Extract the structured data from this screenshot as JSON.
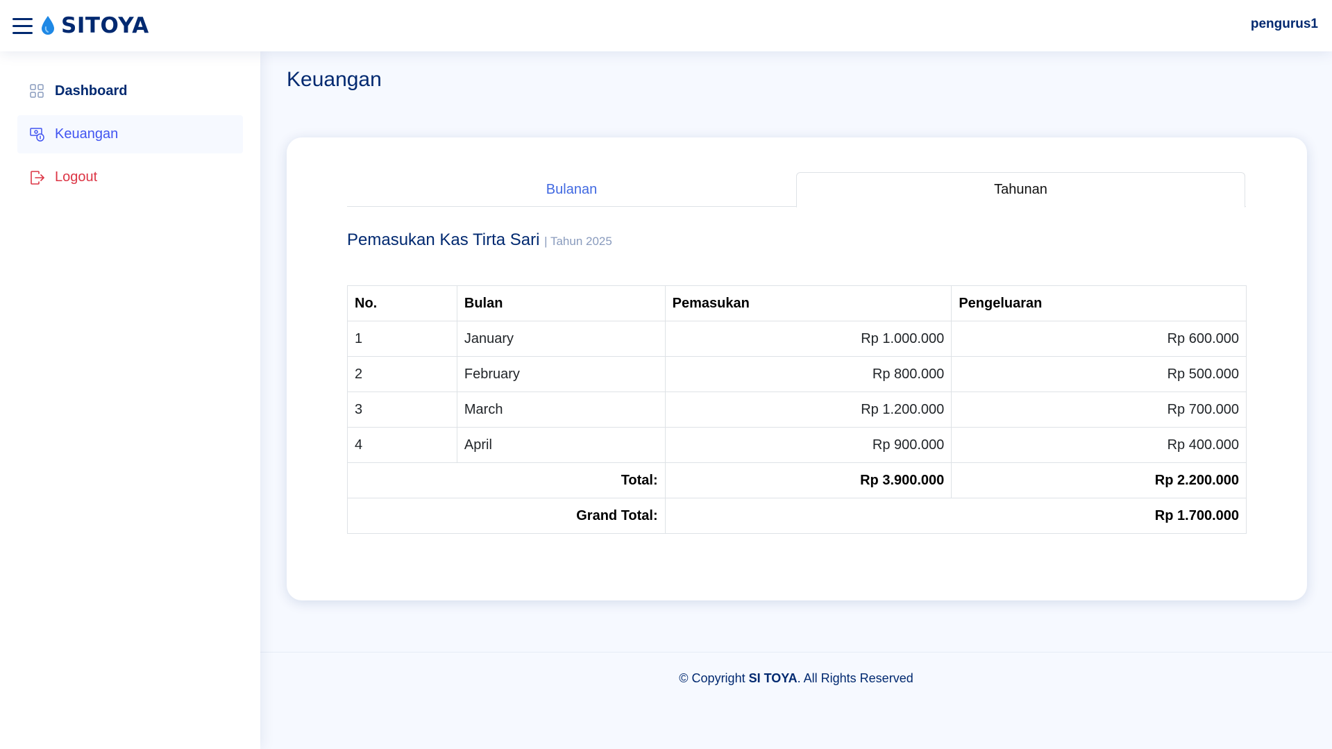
{
  "header": {
    "brand": "SITOYA",
    "user": "pengurus1"
  },
  "sidebar": {
    "items": [
      {
        "label": "Dashboard",
        "icon": "grid-icon"
      },
      {
        "label": "Keuangan",
        "icon": "cash-coin-icon"
      },
      {
        "label": "Logout",
        "icon": "logout-icon"
      }
    ]
  },
  "main": {
    "page_title": "Keuangan",
    "tabs": [
      {
        "label": "Bulanan"
      },
      {
        "label": "Tahunan"
      }
    ],
    "section_title": "Pemasukan Kas Tirta Sari",
    "section_subtitle": "| Tahun 2025",
    "table": {
      "headers": [
        "No.",
        "Bulan",
        "Pemasukan",
        "Pengeluaran"
      ],
      "rows": [
        [
          "1",
          "January",
          "Rp 1.000.000",
          "Rp 600.000"
        ],
        [
          "2",
          "February",
          "Rp 800.000",
          "Rp 500.000"
        ],
        [
          "3",
          "March",
          "Rp 1.200.000",
          "Rp 700.000"
        ],
        [
          "4",
          "April",
          "Rp 900.000",
          "Rp 400.000"
        ]
      ],
      "total_label": "Total:",
      "total_pemasukan": "Rp 3.900.000",
      "total_pengeluaran": "Rp 2.200.000",
      "grand_total_label": "Grand Total:",
      "grand_total": "Rp 1.700.000"
    }
  },
  "footer": {
    "prefix": "© Copyright",
    "brand": "SI TOYA",
    "suffix": ". All Rights Reserved"
  },
  "colors": {
    "primary": "#012970",
    "accent": "#4154f1",
    "logout": "#dc3545",
    "water_drop": "#1e88e5"
  }
}
